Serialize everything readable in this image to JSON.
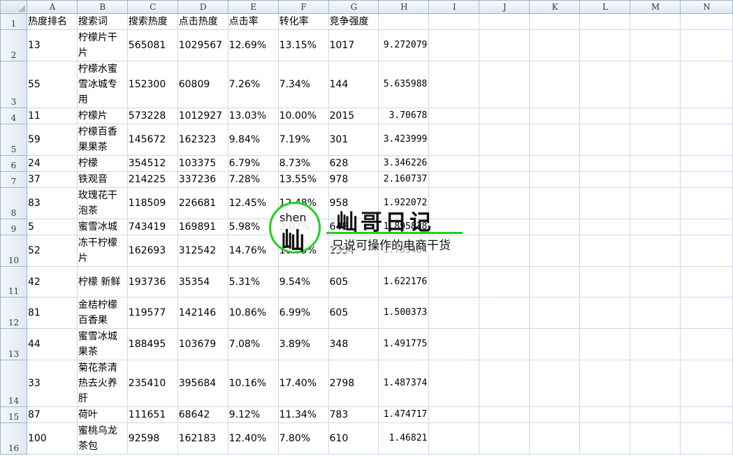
{
  "columns": [
    "",
    "A",
    "B",
    "C",
    "D",
    "E",
    "F",
    "G",
    "H",
    "I",
    "J",
    "K",
    "L",
    "M",
    "N"
  ],
  "header_row": {
    "num": "1",
    "cells": [
      "热度排名",
      "搜索词",
      "搜索热度",
      "点击热度",
      "点击率",
      "转化率",
      "竞争强度",
      ""
    ]
  },
  "rows": [
    {
      "num": "2",
      "cells": [
        "13",
        "柠檬片干片",
        "565081",
        "1029567",
        "12.69%",
        "13.15%",
        "1017",
        "9.272079"
      ]
    },
    {
      "num": "3",
      "cells": [
        "55",
        "柠檬水蜜雪冰城专用",
        "152300",
        "60809",
        "7.26%",
        "7.34%",
        "144",
        "5.635988"
      ]
    },
    {
      "num": "4",
      "cells": [
        "11",
        "柠檬片",
        "573228",
        "1012927",
        "13.03%",
        "10.00%",
        "2015",
        "3.70678"
      ]
    },
    {
      "num": "5",
      "cells": [
        "59",
        "柠檬百香果果茶",
        "145672",
        "162323",
        "9.84%",
        "7.19%",
        "301",
        "3.423999"
      ]
    },
    {
      "num": "6",
      "cells": [
        "24",
        "柠檬",
        "354512",
        "103375",
        "6.79%",
        "8.73%",
        "628",
        "3.346226"
      ]
    },
    {
      "num": "7",
      "cells": [
        "37",
        "铁观音",
        "214225",
        "337236",
        "7.28%",
        "13.55%",
        "978",
        "2.160737"
      ]
    },
    {
      "num": "8",
      "cells": [
        "83",
        "玫瑰花干泡茶",
        "118509",
        "226681",
        "12.45%",
        "12.48%",
        "958",
        "1.922072"
      ]
    },
    {
      "num": "9",
      "cells": [
        "5",
        "蜜雪冰城",
        "743419",
        "169891",
        "5.98%",
        "2.02%",
        "645",
        "1.895838"
      ]
    },
    {
      "num": "10",
      "cells": [
        "52",
        "冻干柠檬片",
        "162693",
        "312542",
        "14.76%",
        "10.09%",
        "1354",
        "1.789484"
      ]
    },
    {
      "num": "11",
      "cells": [
        "42",
        "柠檬 新鲜",
        "193736",
        "35354",
        "5.31%",
        "9.54%",
        "605",
        "1.622176"
      ]
    },
    {
      "num": "12",
      "cells": [
        "81",
        "金桔柠檬百香果",
        "119577",
        "142146",
        "10.86%",
        "6.99%",
        "605",
        "1.500373"
      ]
    },
    {
      "num": "13",
      "cells": [
        "44",
        "蜜雪冰城果茶",
        "188495",
        "103679",
        "7.08%",
        "3.89%",
        "348",
        "1.491775"
      ]
    },
    {
      "num": "14",
      "cells": [
        "33",
        "菊花茶清热去火养肝",
        "235410",
        "395684",
        "10.16%",
        "17.40%",
        "2798",
        "1.487374"
      ]
    },
    {
      "num": "15",
      "cells": [
        "87",
        "荷叶",
        "111651",
        "68642",
        "9.12%",
        "11.34%",
        "783",
        "1.474717"
      ]
    },
    {
      "num": "16",
      "cells": [
        "100",
        "蜜桃乌龙茶包",
        "92598",
        "162183",
        "12.40%",
        "7.80%",
        "610",
        "1.46821"
      ]
    }
  ],
  "watermark": {
    "pinyin": "shen",
    "char": "屾",
    "title": "屾哥日记",
    "subtitle": "只说可操作的电商干货"
  },
  "colors": {
    "header_bg": "#dfe6ef",
    "grid": "#d0d7e5",
    "watermark_green": "#1ed21e"
  }
}
